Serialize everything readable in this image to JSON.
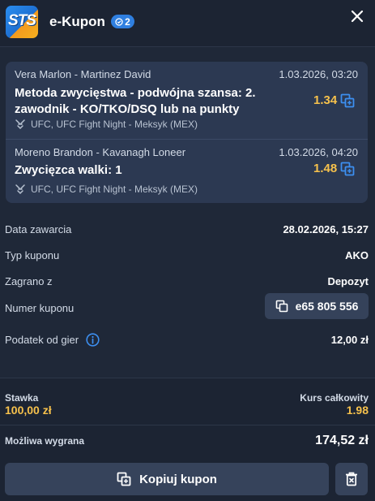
{
  "header": {
    "logo_text": "STS",
    "title": "e-Kupon",
    "badge_count": "2"
  },
  "bets": [
    {
      "teams": "Vera Marlon - Martinez David",
      "date": "1.03.2026, 03:20",
      "market": "Metoda zwycięstwa - podwójna szansa: 2. zawodnik - KO/TKO/DSQ lub na punkty",
      "odds": "1.34",
      "league": "UFC, UFC Fight Night - Meksyk (MEX)"
    },
    {
      "teams": "Moreno Brandon - Kavanagh Loneer",
      "date": "1.03.2026, 04:20",
      "market": "Zwycięzca walki: 1",
      "odds": "1.48",
      "league": "UFC, UFC Fight Night - Meksyk (MEX)"
    }
  ],
  "details": {
    "date_label": "Data zawarcia",
    "date_value": "28.02.2026, 15:27",
    "type_label": "Typ kuponu",
    "type_value": "AKO",
    "played_label": "Zagrano z",
    "played_value": "Depozyt",
    "number_label": "Numer kuponu",
    "number_value": "e65 805 556",
    "tax_label": "Podatek od gier",
    "tax_value": "12,00 zł"
  },
  "summary": {
    "stake_label": "Stawka",
    "stake_value": "100,00 zł",
    "odds_label": "Kurs całkowity",
    "odds_value": "1.98",
    "win_label": "Możliwa wygrana",
    "win_value": "174,52 zł"
  },
  "actions": {
    "copy_label": "Kopiuj kupon"
  },
  "colors": {
    "background": "#1f2838",
    "card": "#2c3952",
    "accent_gold": "#f6c14c",
    "accent_blue": "#2f7fe0"
  },
  "icons": [
    "close-icon",
    "ticket-icon",
    "copy-icon",
    "ufc-icon",
    "info-icon",
    "trash-icon"
  ]
}
